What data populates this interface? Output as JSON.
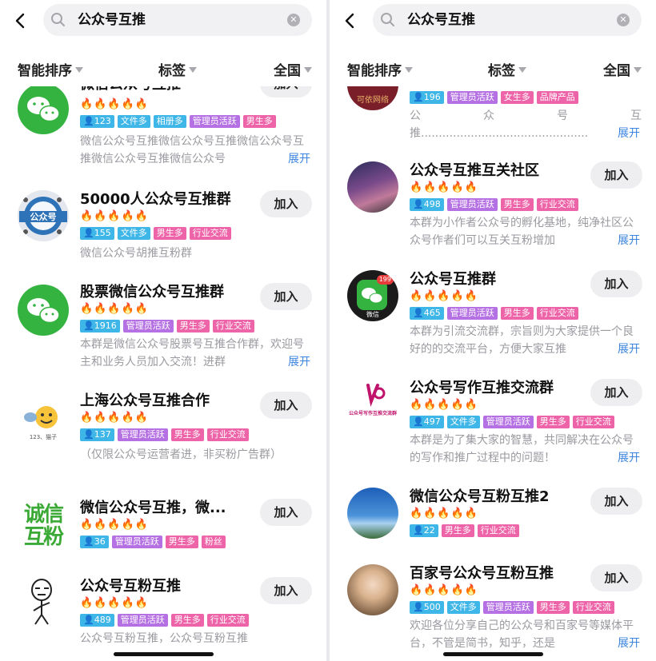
{
  "search": {
    "query": "公众号互推"
  },
  "filters": [
    {
      "label": "智能排序"
    },
    {
      "label": "标签"
    },
    {
      "label": "全国"
    }
  ],
  "left_list": [
    {
      "title": "微信公众号互推",
      "fires": 4,
      "members": "123",
      "tags": [
        {
          "t": "文件多",
          "c": "#3eb6e8"
        },
        {
          "t": "相册多",
          "c": "#3eb6e8"
        },
        {
          "t": "管理员活跃",
          "c": "#b571e3"
        },
        {
          "t": "男生多",
          "c": "#ee64a8"
        }
      ],
      "desc": "微信公众号互推微信公众号互推微信公众号互推微信公众号互推微信公众号",
      "expand": "展开",
      "join": "加入",
      "avatar": "wechat-icon"
    },
    {
      "title": "50000人公众号互推群",
      "fires": 4.5,
      "members": "155",
      "tags": [
        {
          "t": "文件多",
          "c": "#3eb6e8"
        },
        {
          "t": "男生多",
          "c": "#ee64a8"
        },
        {
          "t": "行业交流",
          "c": "#ee64a8"
        }
      ],
      "desc": "微信公众号胡推互粉群",
      "join": "加入",
      "avatar": "gongzhonghao-badge",
      "avatar_text": "公众号"
    },
    {
      "title": "股票微信公众号互推群",
      "fires": 3,
      "members": "1916",
      "tags": [
        {
          "t": "管理员活跃",
          "c": "#b571e3"
        },
        {
          "t": "男生多",
          "c": "#ee64a8"
        },
        {
          "t": "行业交流",
          "c": "#ee64a8"
        }
      ],
      "desc": "本群是微信公众号股票号互推合作群，欢迎号主和业务人员加入交流！进群",
      "expand": "展开",
      "join": "加入",
      "avatar": "wechat-icon"
    },
    {
      "title": "上海公众号互推合作",
      "fires": 4.5,
      "members": "137",
      "tags": [
        {
          "t": "管理员活跃",
          "c": "#b571e3"
        },
        {
          "t": "男生多",
          "c": "#ee64a8"
        },
        {
          "t": "行业交流",
          "c": "#ee64a8"
        }
      ],
      "desc": "（仅限公众号运营者进，非买粉广告群）",
      "join": "加入",
      "avatar": "smiley-sticker",
      "avatar_text": "123、猫子"
    },
    {
      "title": "微信公众号互推，微...",
      "fires": 2.5,
      "members": "36",
      "tags": [
        {
          "t": "管理员活跃",
          "c": "#b571e3"
        },
        {
          "t": "男生多",
          "c": "#ee64a8"
        },
        {
          "t": "粉丝",
          "c": "#ee64a8"
        }
      ],
      "desc": "",
      "join": "加入",
      "avatar": "chengxin-hufen-logo",
      "avatar_text": "诚信互粉"
    },
    {
      "title": "公众号互粉互推",
      "fires": 4.5,
      "members": "489",
      "tags": [
        {
          "t": "管理员活跃",
          "c": "#b571e3"
        },
        {
          "t": "男生多",
          "c": "#ee64a8"
        },
        {
          "t": "行业交流",
          "c": "#ee64a8"
        }
      ],
      "desc": "公众号互粉互推，公众号互粉互推",
      "join": "加入",
      "avatar": "meme-face-sticker"
    }
  ],
  "right_list": [
    {
      "title": "",
      "members": "196",
      "tags": [
        {
          "t": "管理员活跃",
          "c": "#b571e3"
        },
        {
          "t": "女生多",
          "c": "#ee64a8"
        },
        {
          "t": "品牌产品",
          "c": "#ee64a8"
        }
      ],
      "desc_line1": [
        "公",
        "众",
        "号",
        "互"
      ],
      "desc_line2": "推...............................................",
      "expand": "展开",
      "avatar_text": "可依网络"
    },
    {
      "title": "公众号互推互关社区",
      "fires": 3.5,
      "members": "498",
      "tags": [
        {
          "t": "管理员活跃",
          "c": "#b571e3"
        },
        {
          "t": "男生多",
          "c": "#ee64a8"
        },
        {
          "t": "行业交流",
          "c": "#ee64a8"
        }
      ],
      "desc": "本群为小作者公众号的孵化基地，纯净社区公众号作者们可以互关互粉增加",
      "expand": "展开",
      "join": "加入",
      "avatar": "night-sky-photo"
    },
    {
      "title": "公众号互推群",
      "fires": 2.5,
      "members": "465",
      "tags": [
        {
          "t": "管理员活跃",
          "c": "#b571e3"
        },
        {
          "t": "男生多",
          "c": "#ee64a8"
        },
        {
          "t": "行业交流",
          "c": "#ee64a8"
        }
      ],
      "desc": "本群为引流交流群，宗旨则为大家提供一个良好的的交流平台，方便大家互推",
      "expand": "展开",
      "join": "加入",
      "avatar": "wechat-badge-icon",
      "avatar_badge": "199",
      "avatar_text": "微信"
    },
    {
      "title": "公众号写作互推交流群",
      "fires": 3.5,
      "members": "497",
      "tags": [
        {
          "t": "文件多",
          "c": "#3eb6e8"
        },
        {
          "t": "管理员活跃",
          "c": "#b571e3"
        },
        {
          "t": "男生多",
          "c": "#ee64a8"
        },
        {
          "t": "行业交流",
          "c": "#ee64a8"
        }
      ],
      "desc": "本群是为了集大家的智慧，共同解决在公众号的写作和推广过程中的问题！",
      "expand": "展开",
      "join": "加入",
      "avatar": "writing-logo",
      "avatar_text": "公众号写作互推交流群"
    },
    {
      "title": "微信公众号互粉互推2",
      "fires": 0,
      "members": "22",
      "tags": [
        {
          "t": "男生多",
          "c": "#ee64a8"
        },
        {
          "t": "行业交流",
          "c": "#ee64a8"
        }
      ],
      "desc": "",
      "join": "加入",
      "avatar": "sky-photo"
    },
    {
      "title": "百家号公众号互粉互推",
      "fires": 3.5,
      "members": "500",
      "tags": [
        {
          "t": "文件多",
          "c": "#3eb6e8"
        },
        {
          "t": "管理员活跃",
          "c": "#b571e3"
        },
        {
          "t": "男生多",
          "c": "#ee64a8"
        },
        {
          "t": "行业交流",
          "c": "#ee64a8"
        }
      ],
      "desc": "欢迎各位分享自己的公众号和百家号等媒体平台，不管是简书，知乎，还是",
      "expand": "展开",
      "join": "加入",
      "avatar": "portrait-photo"
    }
  ]
}
